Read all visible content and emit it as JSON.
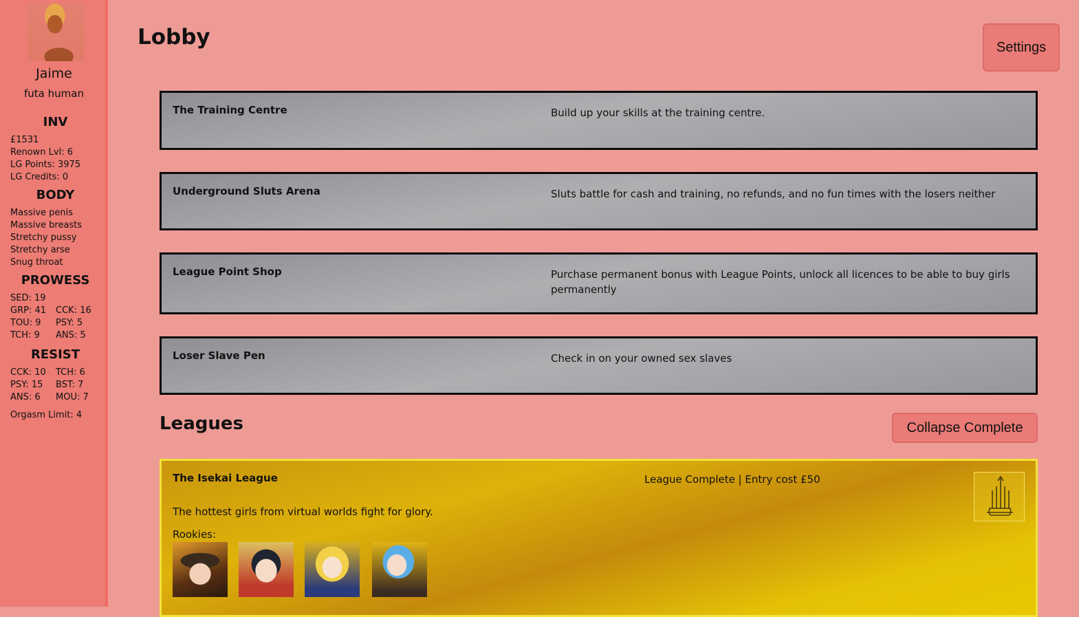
{
  "sidebar": {
    "name": "Jaime",
    "desc": "futa human",
    "inv": {
      "title": "INV",
      "lines": [
        "£1531",
        "Renown Lvl: 6",
        "LG Points: 3975",
        "LG Credits: 0"
      ]
    },
    "body": {
      "title": "BODY",
      "lines": [
        "Massive penis",
        "Massive breasts",
        "Stretchy pussy",
        "Stretchy arse",
        "Snug throat"
      ]
    },
    "prowess": {
      "title": "PROWESS",
      "sed": "SED: 19",
      "grp": "GRP: 41",
      "cck": "CCK: 16",
      "tou": "TOU: 9",
      "psy": "PSY: 5",
      "tch": "TCH: 9",
      "ans": "ANS: 5"
    },
    "resist": {
      "title": "RESIST",
      "cck": "CCK: 10",
      "tch": "TCH: 6",
      "psy": "PSY: 15",
      "bst": "BST: 7",
      "ans": "ANS: 6",
      "mou": "MOU: 7"
    },
    "orgasm_limit": "Orgasm Limit: 4"
  },
  "header": {
    "title": "Lobby",
    "settings_label": "Settings"
  },
  "locations": [
    {
      "name": "The Training Centre",
      "desc": "Build up your skills at the training centre."
    },
    {
      "name": "Underground Sluts Arena",
      "desc": "Sluts battle for cash and training, no refunds, and no fun times with the losers neither"
    },
    {
      "name": "League Point Shop",
      "desc": "Purchase permanent bonus with League Points, unlock all licences to be able to buy girls permanently"
    },
    {
      "name": "Loser Slave Pen",
      "desc": "Check in on your owned sex slaves"
    }
  ],
  "leagues": {
    "title": "Leagues",
    "collapse_label": "Collapse Complete",
    "items": [
      {
        "name": "The Isekai League",
        "status": "League Complete | Entry cost £50",
        "desc": "The hottest girls from virtual worlds fight for glory.",
        "rookies_label": "Rookies:",
        "trophy_icon": "trophy-icon"
      }
    ]
  }
}
